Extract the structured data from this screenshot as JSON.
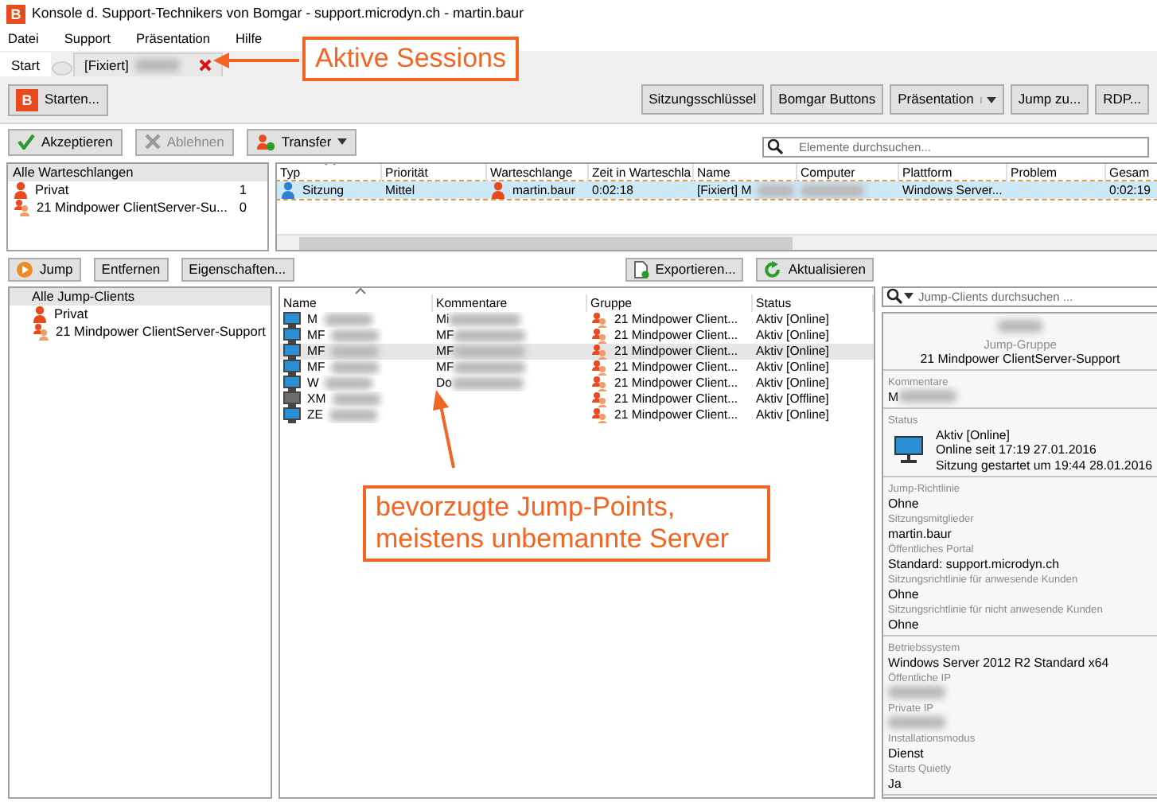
{
  "window": {
    "logo": "B",
    "title": "Konsole d. Support-Technikers von Bomgar - support.microdyn.ch - martin.baur"
  },
  "menu": [
    "Datei",
    "Support",
    "Präsentation",
    "Hilfe"
  ],
  "tabs": [
    {
      "label": "Start",
      "selected": true,
      "kind": "home"
    },
    {
      "label": "[Fixiert]",
      "selected": false,
      "kind": "session",
      "blurred": true
    }
  ],
  "toolbar": {
    "start_button": {
      "logo": "B",
      "label": "Starten..."
    },
    "buttons": [
      {
        "label": "Sitzungsschlüssel",
        "dropdown": false
      },
      {
        "label": "Bomgar Buttons",
        "dropdown": false
      },
      {
        "label": "Präsentation",
        "dropdown": true
      },
      {
        "label": "Jump zu...",
        "dropdown": false
      },
      {
        "label": "RDP...",
        "dropdown": false
      }
    ]
  },
  "session_toolbar": {
    "buttons": [
      {
        "label": "Akzeptieren",
        "kind": "accept",
        "disabled": false,
        "dropdown": false
      },
      {
        "label": "Ablehnen",
        "kind": "reject",
        "disabled": true,
        "dropdown": false
      },
      {
        "label": "Transfer",
        "kind": "transfer",
        "disabled": false,
        "dropdown": true
      }
    ],
    "search": {
      "placeholder": "Elemente durchsuchen..."
    }
  },
  "queues": {
    "header": "Alle Warteschlangen",
    "items": [
      {
        "name": "Privat",
        "kind": "person",
        "count": "1"
      },
      {
        "name": "21 Mindpower ClientServer-Su...",
        "kind": "group",
        "count": "0"
      }
    ]
  },
  "sessions": {
    "columns": [
      "Typ",
      "Priorität",
      "Warteschlange",
      "Zeit in Warteschla",
      "Name",
      "Computer",
      "Plattform",
      "Problem",
      "Gesam"
    ],
    "rows": [
      {
        "selected": true,
        "type": "Sitzung",
        "priority": "Mittel",
        "queue": "martin.baur",
        "wait": "0:02:18",
        "name": "[Fixiert] M",
        "blurred": true,
        "platform": "Windows Server...",
        "total": "0:02:19"
      }
    ]
  },
  "jump_toolbar": {
    "left": [
      {
        "label": "Jump",
        "kind": "jump"
      },
      {
        "label": "Entfernen",
        "kind": "plain"
      },
      {
        "label": "Eigenschaften...",
        "kind": "plain"
      }
    ],
    "right": [
      {
        "label": "Exportieren...",
        "kind": "export"
      },
      {
        "label": "Aktualisieren",
        "kind": "refresh"
      }
    ],
    "search": {
      "placeholder": "Jump-Clients durchsuchen ..."
    }
  },
  "jump_tree": {
    "label": "Alle Jump-Clients",
    "selected": true,
    "children": [
      {
        "label": "Privat",
        "kind": "person",
        "selected": false
      },
      {
        "label": "21 Mindpower ClientServer-Support",
        "kind": "group",
        "selected": false
      }
    ]
  },
  "jump_clients": {
    "columns": [
      "Name",
      "Kommentare",
      "Gruppe",
      "Status"
    ],
    "rows": [
      {
        "name": "M",
        "comment": "Mi",
        "group": "21 Mindpower Client...",
        "status": "Aktiv [Online]",
        "online": true,
        "hovered": false
      },
      {
        "name": "MF",
        "comment": "MF",
        "group": "21 Mindpower Client...",
        "status": "Aktiv [Online]",
        "online": true,
        "hovered": false
      },
      {
        "name": "MF",
        "comment": "MF",
        "group": "21 Mindpower Client...",
        "status": "Aktiv [Online]",
        "online": true,
        "hovered": true
      },
      {
        "name": "MF",
        "comment": "MF",
        "group": "21 Mindpower Client...",
        "status": "Aktiv [Online]",
        "online": true,
        "hovered": false
      },
      {
        "name": "W",
        "comment": "Do",
        "group": "21 Mindpower Client...",
        "status": "Aktiv [Online]",
        "online": true,
        "hovered": false
      },
      {
        "name": "XM",
        "group": "21 Mindpower Client...",
        "status": "Aktiv [Offline]",
        "online": false,
        "hovered": false
      },
      {
        "name": "ZE",
        "group": "21 Mindpower Client...",
        "status": "Aktiv [Online]",
        "online": true,
        "hovered": false
      }
    ]
  },
  "details": {
    "title_blurred": true,
    "group_label": "Jump-Gruppe",
    "group": "21 Mindpower ClientServer-Support",
    "sections": [
      [
        {
          "label": "Kommentare",
          "value": "M",
          "blurred": true
        }
      ],
      [
        {
          "label": "Status",
          "kind": "status",
          "online": true,
          "lines": [
            "Aktiv [Online]",
            "Online seit 17:19 27.01.2016",
            "Sitzung gestartet um 19:44 28.01.2016"
          ]
        }
      ],
      [
        {
          "label": "Jump-Richtlinie",
          "value": "Ohne"
        },
        {
          "label": "Sitzungsmitglieder",
          "value": "martin.baur"
        },
        {
          "label": "Öffentliches Portal",
          "value": "Standard: support.microdyn.ch"
        },
        {
          "label": "Sitzungsrichtlinie für anwesende Kunden",
          "value": "Ohne"
        },
        {
          "label": "Sitzungsrichtlinie für nicht anwesende Kunden",
          "value": "Ohne"
        }
      ],
      [
        {
          "label": "Betriebssystem",
          "value": "Windows Server 2012 R2 Standard x64"
        },
        {
          "label": "Öffentliche IP",
          "blurred": true
        },
        {
          "label": "Private IP",
          "blurred": true
        },
        {
          "label": "Installationsmodus",
          "value": "Dienst"
        },
        {
          "label": "Starts Quietly",
          "value": "Ja"
        }
      ]
    ]
  },
  "annotations": [
    {
      "text": "Aktive Sessions",
      "kind": "tabs"
    },
    {
      "text": "bevorzugte Jump-Points, meistens unbemannte Server",
      "kind": "jump"
    }
  ]
}
